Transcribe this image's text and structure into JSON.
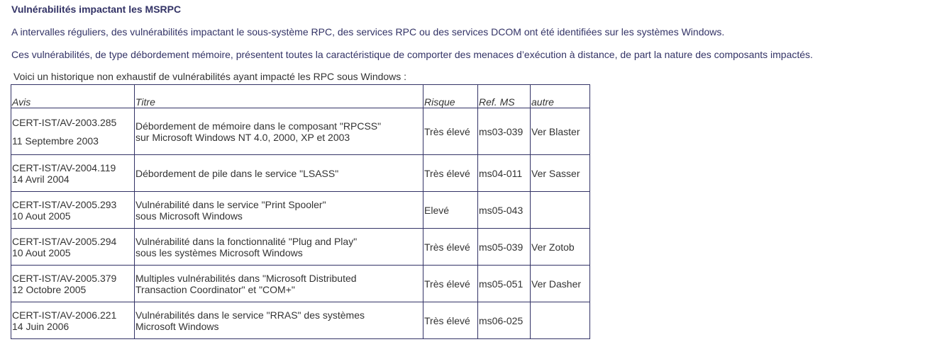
{
  "heading": "Vulnérabilités impactant les MSRPC",
  "paragraphs": [
    "A intervalles réguliers, des vulnérabilités impactant le sous-système RPC, des services RPC ou des services DCOM ont été identifiées sur les systèmes Windows.",
    "Ces vulnérabilités, de type débordement mémoire, présentent toutes la caractéristique de comporter des menaces d’exécution à distance, de part la nature des composants impactés."
  ],
  "intro": "Voici un historique non exhaustif de vulnérabilités ayant impacté les RPC sous Windows :",
  "table": {
    "headers": [
      "Avis",
      "Titre",
      "Risque",
      "Ref. MS",
      "autre"
    ],
    "rows": [
      {
        "avis_id": "CERT-IST/AV-2003.285",
        "avis_date": "11 Septembre 2003",
        "titre_l1": "Débordement de mémoire dans le composant \"RPCSS\"",
        "titre_l2": "sur Microsoft Windows NT 4.0, 2000, XP et 2003",
        "risque": "Très élevé",
        "ref": "ms03-039",
        "autre": "Ver Blaster"
      },
      {
        "avis_id": "CERT-IST/AV-2004.119",
        "avis_date": "14 Avril 2004",
        "titre_l1": "Débordement de pile dans le service \"LSASS\"",
        "titre_l2": "",
        "risque": "Très élevé",
        "ref": "ms04-011",
        "autre": "Ver Sasser"
      },
      {
        "avis_id": "CERT-IST/AV-2005.293",
        "avis_date": "10 Aout 2005",
        "titre_l1": "Vulnérabilité dans le service \"Print Spooler\"",
        "titre_l2": "sous Microsoft Windows",
        "risque": "Elevé",
        "ref": "ms05-043",
        "autre": ""
      },
      {
        "avis_id": "CERT-IST/AV-2005.294",
        "avis_date": "10 Aout 2005",
        "titre_l1": "Vulnérabilité dans la fonctionnalité \"Plug and Play\"",
        "titre_l2": "sous les systèmes Microsoft Windows",
        "risque": "Très élevé",
        "ref": "ms05-039",
        "autre": "Ver Zotob"
      },
      {
        "avis_id": "CERT-IST/AV-2005.379",
        "avis_date": "12 Octobre 2005",
        "titre_l1": "Multiples vulnérabilités dans \"Microsoft Distributed",
        "titre_l2": "Transaction Coordinator\" et \"COM+\"",
        "risque": "Très élevé",
        "ref": "ms05-051",
        "autre": "Ver Dasher"
      },
      {
        "avis_id": "CERT-IST/AV-2006.221",
        "avis_date": "14 Juin 2006",
        "titre_l1": "Vulnérabilités dans le service \"RRAS\" des systèmes",
        "titre_l2": "Microsoft Windows",
        "risque": "Très élevé",
        "ref": "ms06-025",
        "autre": ""
      }
    ]
  }
}
